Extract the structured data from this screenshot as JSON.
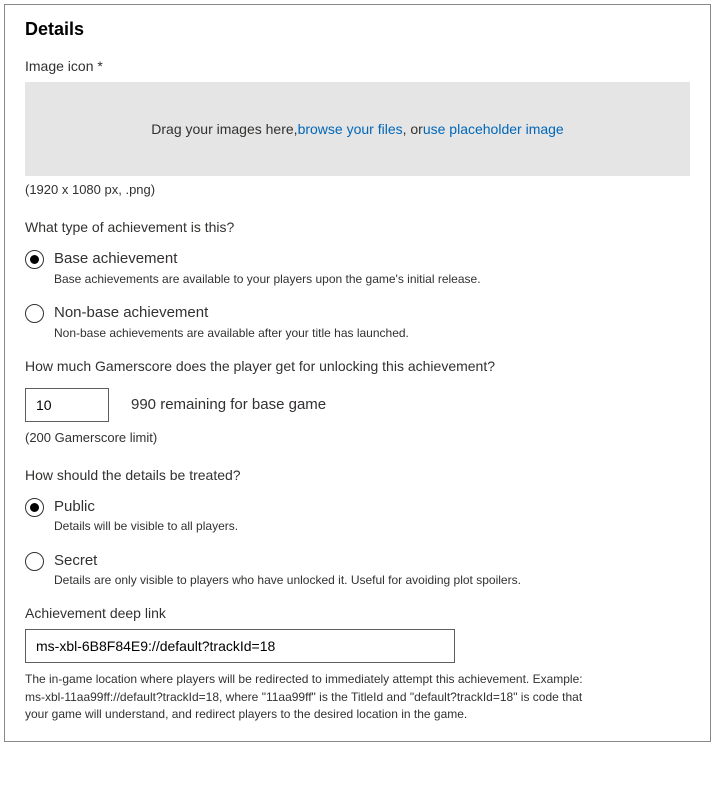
{
  "title": "Details",
  "image_icon": {
    "label": "Image icon *",
    "drop_prefix": "Drag your images here, ",
    "browse_link": "browse your files",
    "drop_middle": ", or ",
    "placeholder_link": "use placeholder image",
    "hint": "(1920 x 1080 px, .png)"
  },
  "achievement_type": {
    "question": "What type of achievement is this?",
    "options": [
      {
        "label": "Base achievement",
        "desc": "Base achievements are available to your players upon the game's initial release.",
        "selected": true
      },
      {
        "label": "Non-base achievement",
        "desc": "Non-base achievements are available after your title has launched.",
        "selected": false
      }
    ]
  },
  "gamerscore": {
    "question": "How much Gamerscore does the player get for unlocking this achievement?",
    "value": "10",
    "remaining": "990 remaining for base game",
    "limit": "(200 Gamerscore limit)"
  },
  "visibility": {
    "question": "How should the details be treated?",
    "options": [
      {
        "label": "Public",
        "desc": "Details will be visible to all players.",
        "selected": true
      },
      {
        "label": "Secret",
        "desc": "Details are only visible to players who have unlocked it. Useful for avoiding plot spoilers.",
        "selected": false
      }
    ]
  },
  "deeplink": {
    "label": "Achievement deep link",
    "value": "ms-xbl-6B8F84E9://default?trackId=18",
    "desc": "The in-game location where players will be redirected to immediately attempt this achievement. Example: ms-xbl-11aa99ff://default?trackId=18, where \"11aa99ff\" is the TitleId and \"default?trackId=18\" is code that your game will understand, and redirect players to the desired location in the game."
  }
}
